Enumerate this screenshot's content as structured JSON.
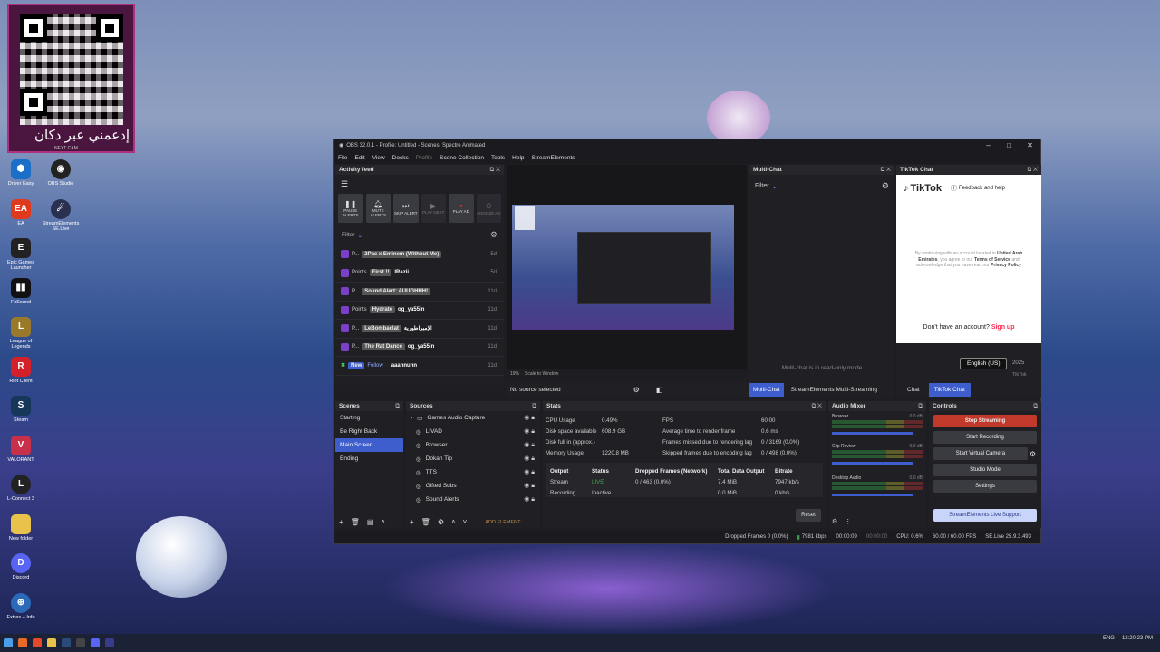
{
  "colors": {
    "accent": "#3d5ecc",
    "twitch": "#7b3fc9",
    "tiktok_bg": "#ffffff",
    "stop_streaming": "#c0392b",
    "live_green": "#3fa34d"
  },
  "qr_panel": {
    "arabic": "إدعمني عبر دكان",
    "caption": "NEXT CAM"
  },
  "desktop_icons": [
    "Driver Easy",
    "EA",
    "Epic Games Launcher",
    "FxSound",
    "League of Legends",
    "Riot Client",
    "Steam",
    "VALORANT",
    "L-Connect 3",
    "New folder",
    "Discord",
    "Extras + Info"
  ],
  "desktop_icons_right": [
    "OBS Studio",
    "StreamElements SE.Live"
  ],
  "obs": {
    "title": "OBS 32.0.1 - Profile: Untitled - Scenes: Spectre Animated",
    "menu": [
      "File",
      "Edit",
      "View",
      "Docks",
      "Profile",
      "Scene Collection",
      "Tools",
      "Help",
      "StreamElements"
    ],
    "activity": {
      "title": "Activity feed",
      "buttons": [
        {
          "icon": "pause-icon",
          "label": "PAUSE ALERTS"
        },
        {
          "icon": "bell-icon",
          "label": "MUTE ALERTS"
        },
        {
          "icon": "skip-icon",
          "label": "SKIP ALERT"
        },
        {
          "icon": "play-next-icon",
          "label": "PLAY NEXT"
        },
        {
          "icon": "play-ad-icon",
          "label": "PLAY AD"
        },
        {
          "icon": "snooze-icon",
          "label": "SNOOZE AD"
        }
      ],
      "filter": "Filter",
      "rows": [
        {
          "kind": "P...",
          "tag": "2Pac x Eminem (Without Me)",
          "user": "",
          "time": "5d"
        },
        {
          "kind": "Points",
          "tag": "First !!",
          "user": "IRazii",
          "time": "5d"
        },
        {
          "kind": "P...",
          "tag": "Sound Alert: AUUGHHH!",
          "user": "",
          "time": "11d"
        },
        {
          "kind": "Points",
          "tag": "Hydrate",
          "user": "og_ya55in",
          "time": "11d"
        },
        {
          "kind": "P...",
          "tag": "LeBombaclat",
          "user": "الإمبراطورية",
          "time": "11d"
        },
        {
          "kind": "P...",
          "tag": "The Rat Dance",
          "user": "og_ya55in",
          "time": "11d"
        },
        {
          "kind": "New",
          "tag": "Follow",
          "user": "aaannunn",
          "time": "11d"
        }
      ]
    },
    "preview": {
      "zoom": "19%",
      "scale": "Scale to Window",
      "no_source": "No source selected"
    },
    "multichat": {
      "title": "Multi-Chat",
      "filter": "Filter",
      "readonly": "Multi-chat is in read-only mode",
      "tabs": [
        "Multi-Chat",
        "StreamElements Multi-Streaming"
      ]
    },
    "tiktok": {
      "title": "TikTok Chat",
      "brand": "TikTok",
      "feedback": "Feedback and help",
      "notice_prefix": "By continuing with an account located in",
      "country": "United Arab Emirates",
      "notice_mid": ", you agree to our",
      "terms": "Terms of Service",
      "notice_mid2": "and acknowledge that you have read our",
      "privacy": "Privacy Policy",
      "no_account": "Don't have an account?",
      "signup": "Sign up",
      "lang": "English (US)",
      "year": "2025",
      "footer": "TikTok",
      "tabs": [
        "Chat",
        "TikTok Chat"
      ]
    },
    "scenes": {
      "title": "Scenes",
      "items": [
        "Starting",
        "Be Right Back",
        "Main Screen",
        "Ending"
      ],
      "selected": 2
    },
    "sources": {
      "title": "Sources",
      "items": [
        "Games Audio Capture",
        "LIVAD",
        "Browser",
        "Dokan Tip",
        "TTS",
        "Gifted Subs",
        "Sound Alerts"
      ],
      "add": "ADD ELEMENT"
    },
    "stats": {
      "title": "Stats",
      "left": [
        [
          "CPU Usage",
          "0.49%"
        ],
        [
          "Disk space available",
          "608.9 GB"
        ],
        [
          "Disk full in (approx.)",
          ""
        ],
        [
          "Memory Usage",
          "1220.8 MB"
        ]
      ],
      "right": [
        [
          "FPS",
          "60.00"
        ],
        [
          "Average time to render frame",
          "0.6 ms"
        ],
        [
          "Frames missed due to rendering lag",
          "0 / 3169 (0.0%)"
        ],
        [
          "Skipped frames due to encoding lag",
          "0 / 498 (0.0%)"
        ]
      ],
      "table_head": [
        "Output",
        "Status",
        "Dropped Frames (Network)",
        "Total Data Output",
        "Bitrate"
      ],
      "table_rows": [
        [
          "Stream",
          "LIVE",
          "0 / 463 (0.0%)",
          "7.4 MiB",
          "7947 kb/s"
        ],
        [
          "Recording",
          "Inactive",
          "",
          "0.0 MiB",
          "0 kb/s"
        ]
      ],
      "reset": "Reset"
    },
    "mixer": {
      "title": "Audio Mixer",
      "channels": [
        {
          "name": "Browser",
          "db": "0.0 dB"
        },
        {
          "name": "Clip Review",
          "db": "0.0 dB"
        },
        {
          "name": "Desktop Audio",
          "db": "0.0 dB"
        }
      ]
    },
    "controls": {
      "title": "Controls",
      "buttons": [
        "Stop Streaming",
        "Start Recording",
        "Start Virtual Camera",
        "Studio Mode",
        "Settings"
      ],
      "live_support": "StreamElements Live Support"
    },
    "status": {
      "dropped": "Dropped Frames 0 (0.0%)",
      "kbps": "7981 kbps",
      "live_time": "00:00:09",
      "rec_time": "00:00:00",
      "cpu": "CPU: 0.6%",
      "fps": "60.00 / 60.00 FPS",
      "version": "SE.Live 25.9.3.493"
    }
  },
  "taskbar": {
    "lang": "ENG",
    "time": "12:20:23 PM"
  }
}
